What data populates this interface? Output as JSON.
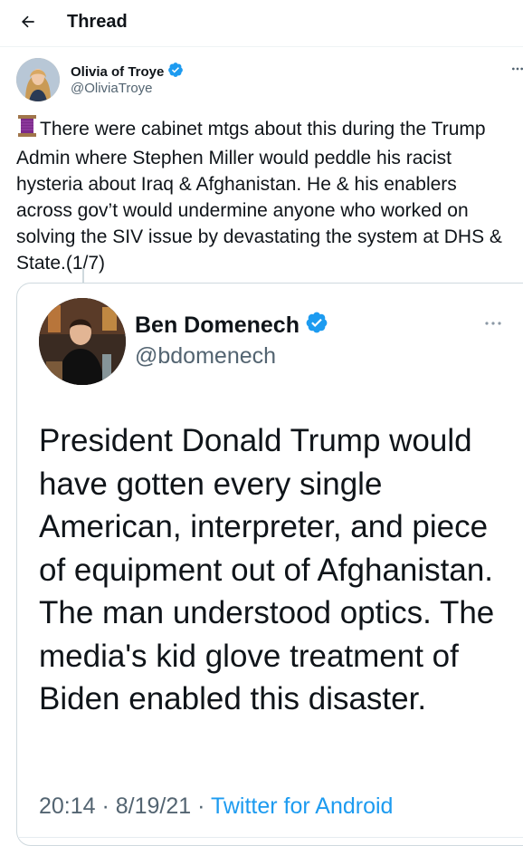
{
  "header": {
    "title": "Thread",
    "back_icon": "arrow-left-icon"
  },
  "author": {
    "name": "Olivia of Troye",
    "handle": "@OliviaTroye",
    "verified": true,
    "more_icon": "more-horizontal-icon"
  },
  "tweet": {
    "emoji_icon": "thread-spool-icon",
    "text": "There were cabinet mtgs about this during the Trump Admin where Stephen Miller would peddle his racist hysteria about Iraq & Afghanistan. He & his enablers across gov’t would undermine anyone who worked on solving the SIV issue by devastating the system at DHS & State.(1/7)"
  },
  "quoted": {
    "name": "Ben Domenech",
    "handle": "@bdomenech",
    "verified": true,
    "more_icon": "more-horizontal-icon",
    "text": "President Donald Trump would have gotten every single American, interpreter, and piece of equipment out of Afghanistan. The man understood optics. The media's kid glove treatment of Biden enabled this disaster.",
    "timestamp": "20:14 · 8/19/21 · ",
    "source": "Twitter for Android"
  },
  "colors": {
    "accent": "#1d9bf0",
    "text": "#0f1419",
    "secondary": "#536471"
  }
}
